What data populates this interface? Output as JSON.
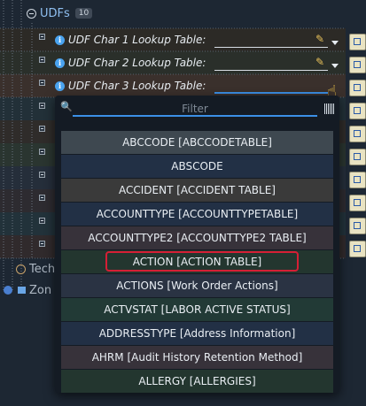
{
  "tree": {
    "udfs_label": "UDFs",
    "udfs_count": "10",
    "fields": [
      {
        "label": "UDF Char 1 Lookup Table:",
        "value": ""
      },
      {
        "label": "UDF Char 2 Lookup Table:",
        "value": ""
      },
      {
        "label": "UDF Char 3 Lookup Table:",
        "value": ""
      }
    ],
    "bottom_items": [
      {
        "label": "Tech"
      },
      {
        "label": "Zon"
      }
    ]
  },
  "dropdown": {
    "filter_placeholder": "Filter",
    "items": [
      "ABCCODE [ABCCODETABLE]",
      "ABSCODE",
      "ACCIDENT [ACCIDENT TABLE]",
      "ACCOUNTTYPE [ACCOUNTTYPETABLE]",
      "ACCOUNTTYPE2 [ACCOUNTTYPE2 TABLE]",
      "ACTION [ACTION TABLE]",
      "ACTIONS [Work Order Actions]",
      "ACTVSTAT [LABOR ACTIVE STATUS]",
      "ADDRESSTYPE [Address Information]",
      "AHRM [Audit History Retention Method]",
      "ALLERGY [ALLERGIES]"
    ],
    "highlighted_item": "ACTION [ACTION TABLE]"
  },
  "colors": {
    "accent": "#3b8fe6",
    "highlight": "#d51f35"
  }
}
